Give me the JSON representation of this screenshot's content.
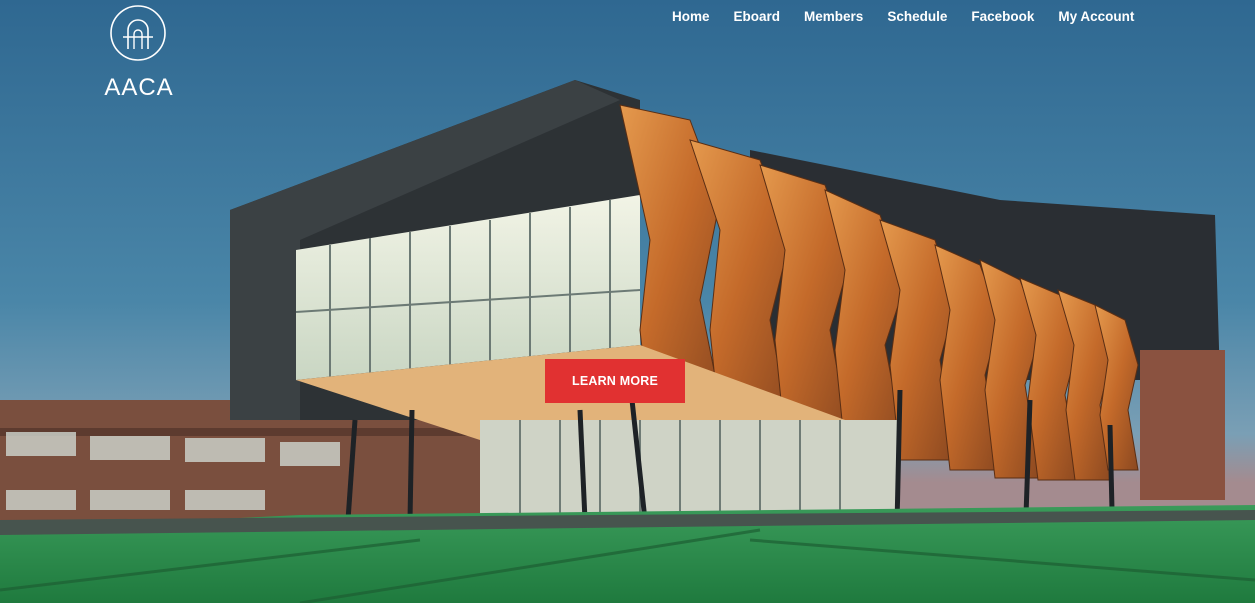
{
  "brand": {
    "name": "AACA",
    "logo_icon": "arch-a-icon"
  },
  "nav": {
    "items": [
      {
        "label": "Home"
      },
      {
        "label": "Eboard"
      },
      {
        "label": "Members"
      },
      {
        "label": "Schedule"
      },
      {
        "label": "Facebook"
      },
      {
        "label": "My Account"
      }
    ]
  },
  "hero": {
    "cta_label": "LEARN MORE",
    "image": "building-at-dusk-photo"
  },
  "colors": {
    "sky": "#3d6f92",
    "cta": "#e13131",
    "facade": "#c9742f",
    "lawn": "#2a8a4c"
  }
}
